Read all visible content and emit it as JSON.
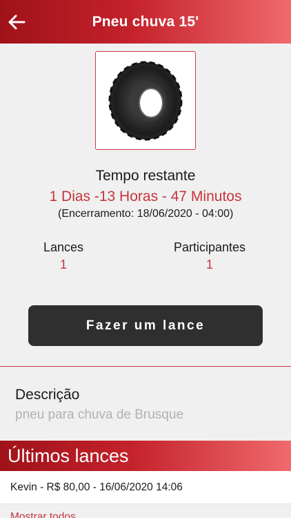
{
  "header": {
    "title": "Pneu chuva 15'",
    "back_icon": "arrow-left-icon"
  },
  "product": {
    "image": "tire-image"
  },
  "auction": {
    "time_label": "Tempo restante",
    "time_value": "1 Dias -13 Horas - 47 Minutos",
    "closing": "(Encerramento: 18/06/2020 - 04:00)"
  },
  "stats": {
    "bids_label": "Lances",
    "bids_value": "1",
    "participants_label": "Participantes",
    "participants_value": "1"
  },
  "action": {
    "bid_label": "Fazer um lance"
  },
  "description": {
    "title": "Descrição",
    "text": "pneu para chuva de Brusque"
  },
  "last_bids": {
    "title": "Últimos lances",
    "rows": [
      {
        "text": "Kevin - R$ 80,00 - 16/06/2020 14:06"
      }
    ],
    "show_all": "Mostrar todos"
  },
  "colors": {
    "accent": "#c6343a",
    "header_dark": "#a01219",
    "header_light": "#f06a6d",
    "button": "#2f2f2f"
  }
}
